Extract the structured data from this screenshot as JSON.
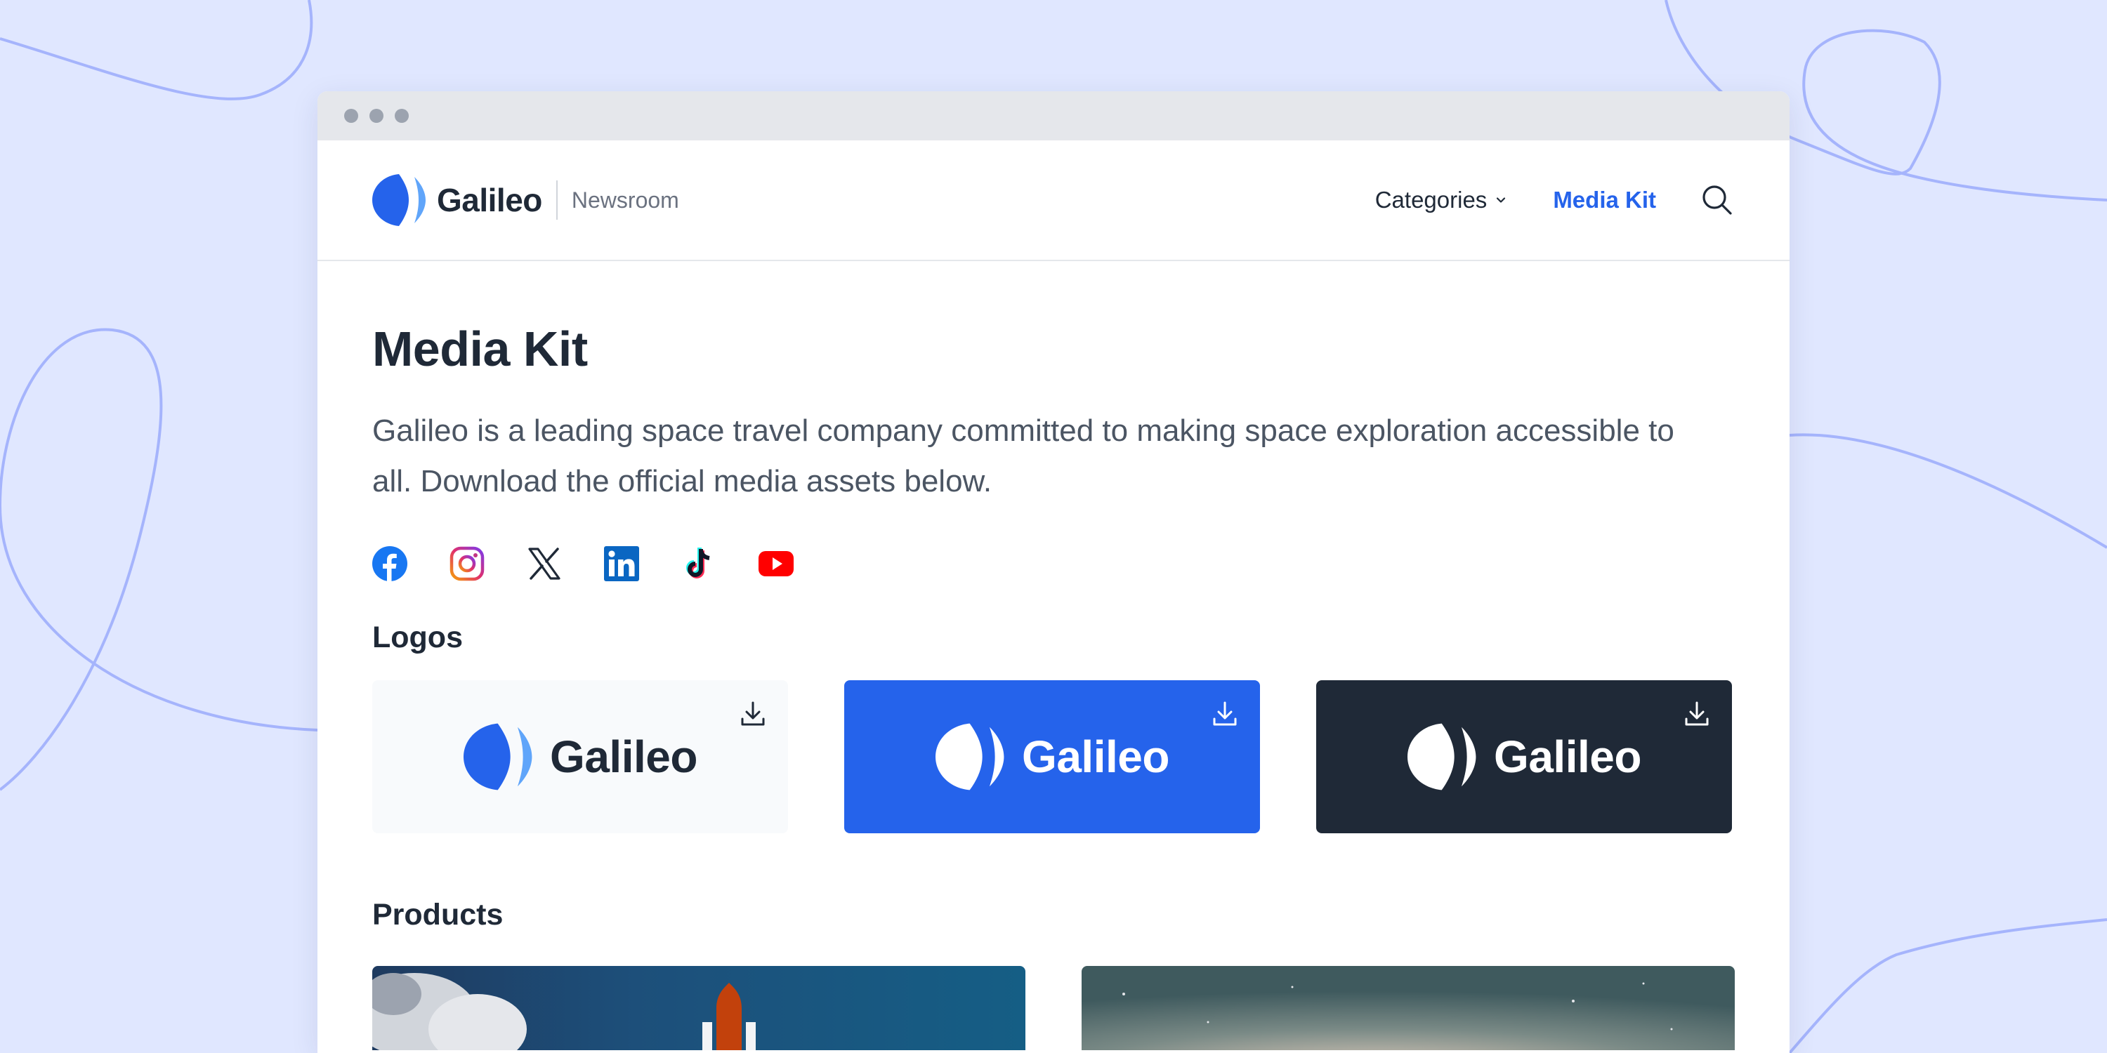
{
  "browser": {
    "dots": 3
  },
  "header": {
    "brand": "Galileo",
    "sub": "Newsroom",
    "nav": {
      "categories": "Categories",
      "media_kit": "Media Kit"
    }
  },
  "main": {
    "title": "Media Kit",
    "description": "Galileo is a leading space travel company committed to making space exploration accessible to all. Download the official media assets below.",
    "social": [
      "facebook-icon",
      "instagram-icon",
      "x-icon",
      "linkedin-icon",
      "tiktok-icon",
      "youtube-icon"
    ],
    "logos_title": "Logos",
    "logos": [
      {
        "variant": "light",
        "word": "Galileo"
      },
      {
        "variant": "blue",
        "word": "Galileo"
      },
      {
        "variant": "dark",
        "word": "Galileo"
      }
    ],
    "products_title": "Products"
  },
  "colors": {
    "background": "#e0e7ff",
    "accent": "#2563eb",
    "dark": "#1f2937",
    "text_muted": "#4b5563"
  }
}
